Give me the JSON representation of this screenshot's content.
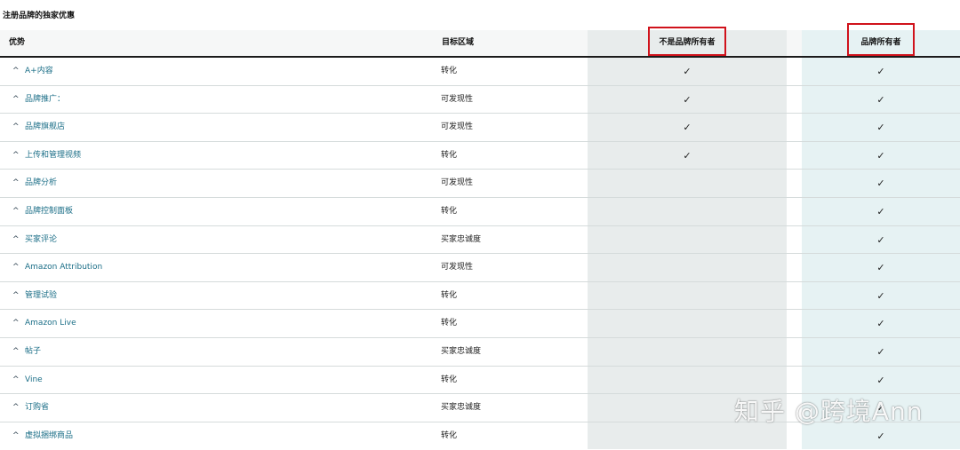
{
  "page": {
    "title": "注册品牌的独家优惠",
    "watermark": "知乎 @跨境Ann"
  },
  "table": {
    "headers": {
      "benefit": "优势",
      "target": "目标区域",
      "nonowner": "不是品牌所有者",
      "owner": "品牌所有者"
    },
    "check_glyph": "✓",
    "rows": [
      {
        "benefit": "A+内容",
        "target": "转化",
        "nonowner": true,
        "owner": true
      },
      {
        "benefit": "品牌推广：",
        "target": "可发现性",
        "nonowner": true,
        "owner": true
      },
      {
        "benefit": "品牌旗舰店",
        "target": "可发现性",
        "nonowner": true,
        "owner": true
      },
      {
        "benefit": "上传和管理视频",
        "target": "转化",
        "nonowner": true,
        "owner": true
      },
      {
        "benefit": "品牌分析",
        "target": "可发现性",
        "nonowner": false,
        "owner": true
      },
      {
        "benefit": "品牌控制面板",
        "target": "转化",
        "nonowner": false,
        "owner": true
      },
      {
        "benefit": "买家评论",
        "target": "买家忠诚度",
        "nonowner": false,
        "owner": true
      },
      {
        "benefit": "Amazon Attribution",
        "target": "可发现性",
        "nonowner": false,
        "owner": true
      },
      {
        "benefit": "管理试验",
        "target": "转化",
        "nonowner": false,
        "owner": true
      },
      {
        "benefit": "Amazon Live",
        "target": "转化",
        "nonowner": false,
        "owner": true
      },
      {
        "benefit": "帖子",
        "target": "买家忠诚度",
        "nonowner": false,
        "owner": true
      },
      {
        "benefit": "Vine",
        "target": "转化",
        "nonowner": false,
        "owner": true
      },
      {
        "benefit": "订购省",
        "target": "买家忠诚度",
        "nonowner": false,
        "owner": true
      },
      {
        "benefit": "虚拟捆绑商品",
        "target": "转化",
        "nonowner": false,
        "owner": true
      }
    ]
  },
  "icons": {
    "expand": "chevron-up-icon",
    "check": "checkmark-icon"
  },
  "colors": {
    "link": "#1b6e87",
    "highlight_box": "#d0121b",
    "nonowner_column": "#e8ecec",
    "owner_column": "#e6f2f3"
  }
}
